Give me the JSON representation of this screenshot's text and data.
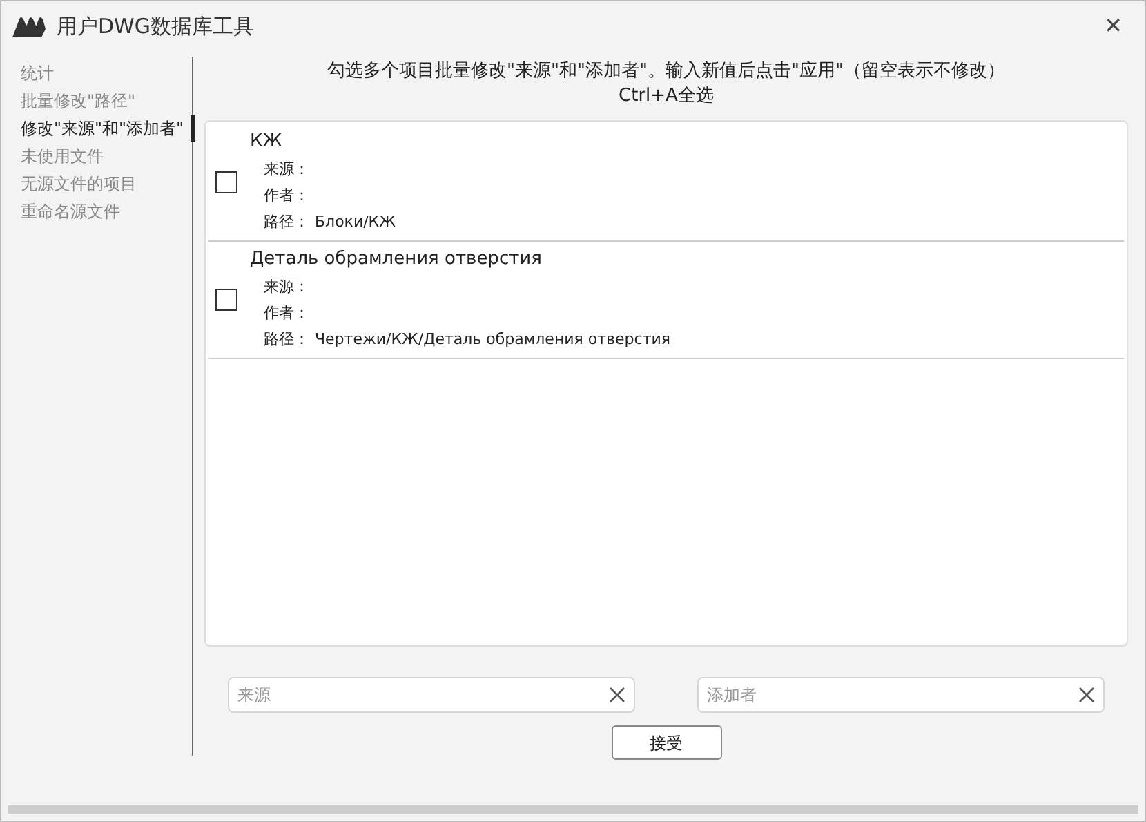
{
  "window": {
    "title": "用户DWG数据库工具",
    "close": "✕"
  },
  "sidebar": {
    "items": [
      {
        "label": "统计",
        "selected": false
      },
      {
        "label": "批量修改\"路径\"",
        "selected": false
      },
      {
        "label": "修改\"来源\"和\"添加者\"",
        "selected": true
      },
      {
        "label": "未使用文件",
        "selected": false
      },
      {
        "label": "无源文件的项目",
        "selected": false
      },
      {
        "label": "重命名源文件",
        "selected": false
      }
    ]
  },
  "instructions": [
    "勾选多个项目批量修改\"来源\"和\"添加者\"。输入新值后点击\"应用\"（留空表示不修改）",
    "Ctrl+A全选"
  ],
  "items": [
    {
      "name": "КЖ",
      "checked": false,
      "fields": [
        {
          "label": "来源："
        },
        {
          "label": "作者："
        },
        {
          "label": "路径：",
          "value": "Блоки/КЖ"
        }
      ]
    },
    {
      "name": "Деталь обрамления отверстия",
      "checked": false,
      "fields": [
        {
          "label": "来源："
        },
        {
          "label": "作者："
        },
        {
          "label": "路径：",
          "value": "Чертежи/КЖ/Деталь обрамления отверстия"
        }
      ]
    }
  ],
  "inputs": [
    {
      "placeholder": "来源"
    },
    {
      "placeholder": "添加者"
    }
  ],
  "apply_button": "接受"
}
